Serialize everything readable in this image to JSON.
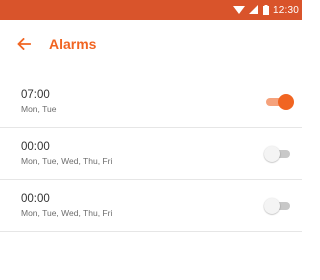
{
  "status_bar": {
    "time": "12:30",
    "background": "#d9542b"
  },
  "app_bar": {
    "title": "Alarms",
    "back_icon": "arrow-left-icon",
    "accent": "#f16522"
  },
  "alarms": [
    {
      "time": "07:00",
      "days": "Mon, Tue",
      "enabled": true
    },
    {
      "time": "00:00",
      "days": "Mon, Tue, Wed, Thu, Fri",
      "enabled": false
    },
    {
      "time": "00:00",
      "days": "Mon, Tue, Wed, Thu, Fri",
      "enabled": false
    }
  ]
}
